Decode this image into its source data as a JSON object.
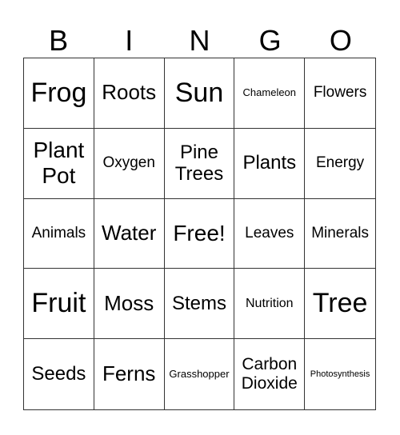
{
  "header": {
    "letters": [
      "B",
      "I",
      "N",
      "G",
      "O"
    ]
  },
  "cells": [
    {
      "text": "Frog"
    },
    {
      "text": "Roots"
    },
    {
      "text": "Sun"
    },
    {
      "text": "Chameleon"
    },
    {
      "text": "Flowers"
    },
    {
      "text": "Plant Pot"
    },
    {
      "text": "Oxygen"
    },
    {
      "text": "Pine Trees"
    },
    {
      "text": "Plants"
    },
    {
      "text": "Energy"
    },
    {
      "text": "Animals"
    },
    {
      "text": "Water"
    },
    {
      "text": "Free!"
    },
    {
      "text": "Leaves"
    },
    {
      "text": "Minerals"
    },
    {
      "text": "Fruit"
    },
    {
      "text": "Moss"
    },
    {
      "text": "Stems"
    },
    {
      "text": "Nutrition"
    },
    {
      "text": "Tree"
    },
    {
      "text": "Seeds"
    },
    {
      "text": "Ferns"
    },
    {
      "text": "Grasshopper"
    },
    {
      "text": "Carbon Dioxide"
    },
    {
      "text": "Photosynthesis"
    }
  ]
}
